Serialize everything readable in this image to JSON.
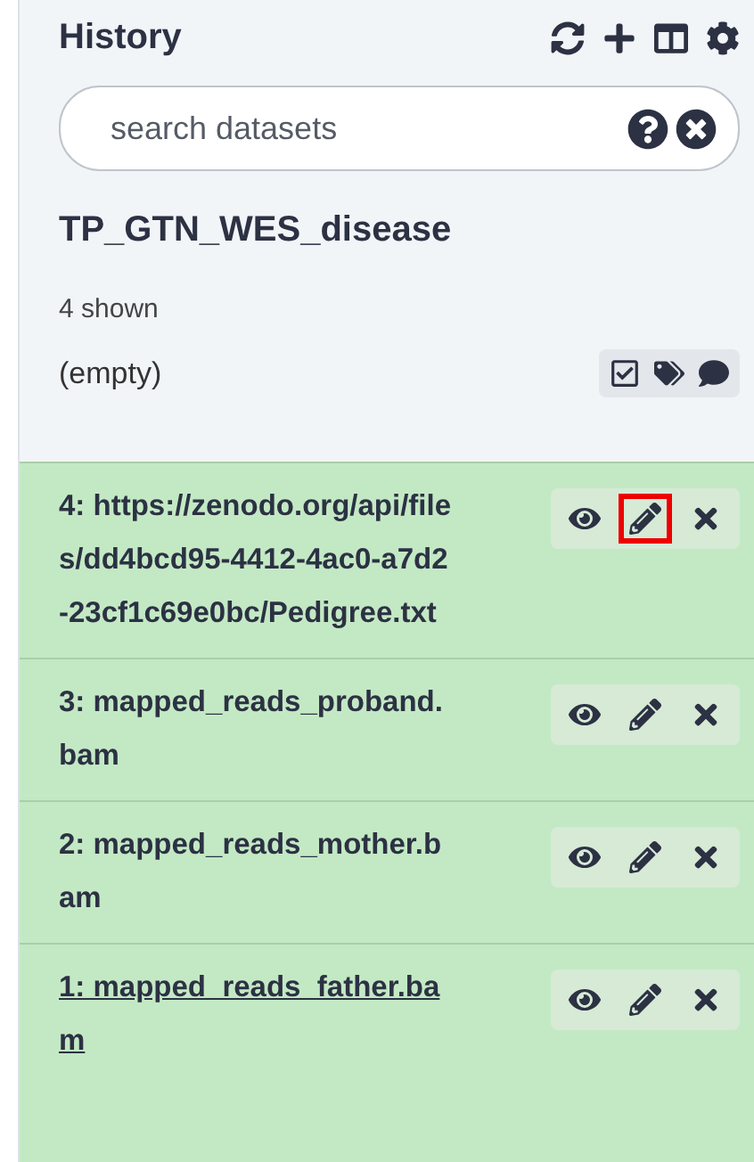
{
  "header": {
    "title": "History"
  },
  "search": {
    "placeholder": "search datasets"
  },
  "history": {
    "name": "TP_GTN_WES_disease",
    "count": "4 shown",
    "annotation": "(empty)"
  },
  "datasets": [
    {
      "name": "4: https://zenodo.org/api/files/dd4bcd95-4412-4ac0-a7d2-23cf1c69e0bc/Pedigree.txt",
      "hovered": false,
      "edit_highlighted": true
    },
    {
      "name": "3: mapped_reads_proband.bam",
      "hovered": false,
      "edit_highlighted": false
    },
    {
      "name": "2: mapped_reads_mother.bam",
      "hovered": false,
      "edit_highlighted": false
    },
    {
      "name": "1: mapped_reads_father.bam",
      "hovered": true,
      "edit_highlighted": false
    }
  ]
}
